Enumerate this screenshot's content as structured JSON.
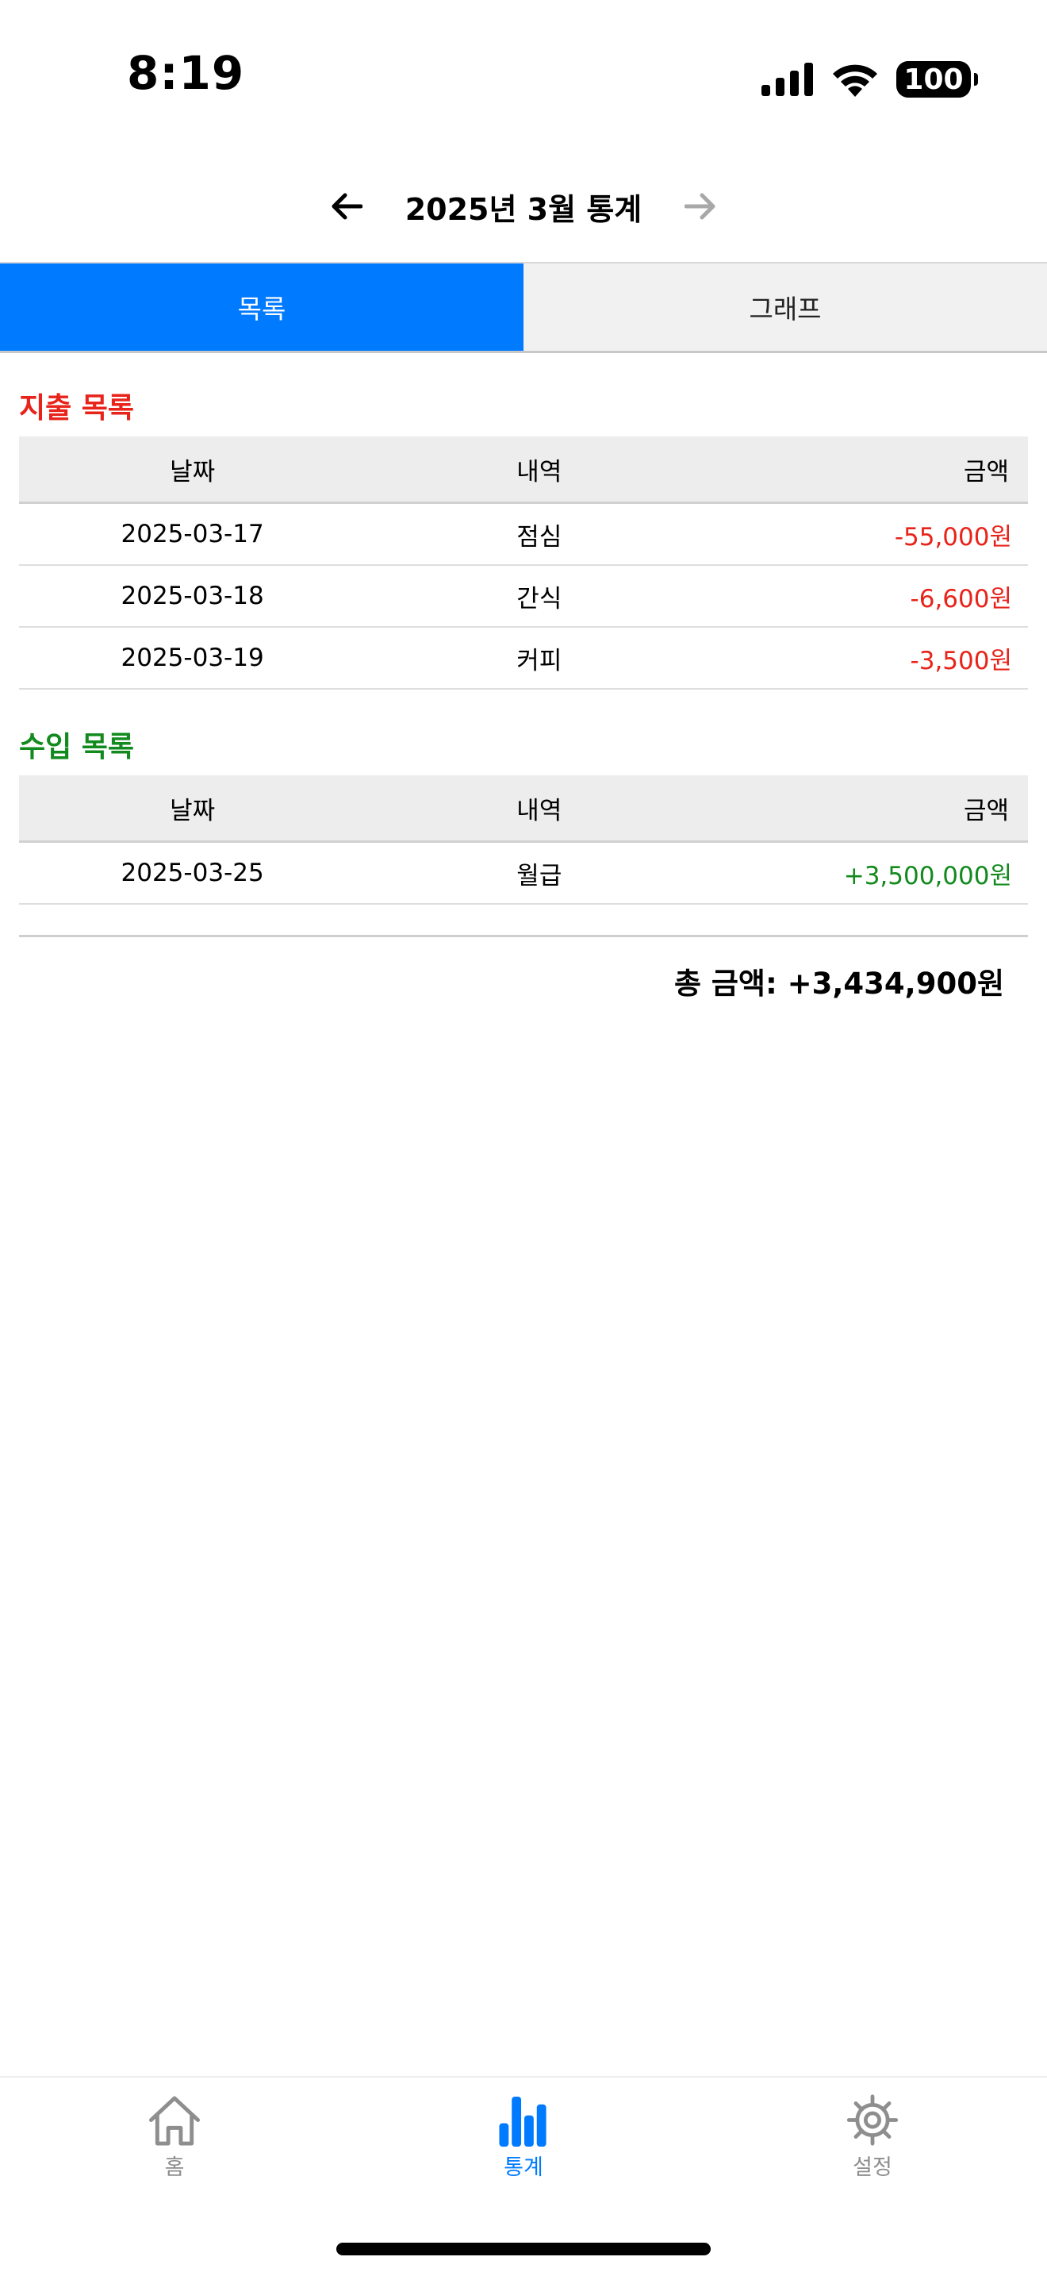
{
  "status_bar": {
    "time": "8:19",
    "battery": "100",
    "icons": [
      "signal-icon",
      "wifi-icon",
      "battery-icon"
    ]
  },
  "header": {
    "title": "2025년 3월 통계",
    "prev_icon": "arrow-left-icon",
    "next_icon": "arrow-right-icon"
  },
  "tabs": [
    {
      "label": "목록",
      "active": true
    },
    {
      "label": "그래프",
      "active": false
    }
  ],
  "expense": {
    "title": "지출 목록",
    "columns": [
      "날짜",
      "내역",
      "금액"
    ],
    "rows": [
      {
        "date": "2025-03-17",
        "desc": "점심",
        "amount": "-55,000원"
      },
      {
        "date": "2025-03-18",
        "desc": "간식",
        "amount": "-6,600원"
      },
      {
        "date": "2025-03-19",
        "desc": "커피",
        "amount": "-3,500원"
      }
    ]
  },
  "income": {
    "title": "수입 목록",
    "columns": [
      "날짜",
      "내역",
      "금액"
    ],
    "rows": [
      {
        "date": "2025-03-25",
        "desc": "월급",
        "amount": "+3,500,000원"
      }
    ]
  },
  "total": "총 금액: +3,434,900원",
  "bottom_nav": [
    {
      "label": "홈",
      "icon": "house-icon",
      "active": false
    },
    {
      "label": "통계",
      "icon": "bar-chart-icon",
      "active": true
    },
    {
      "label": "설정",
      "icon": "gear-icon",
      "active": false
    }
  ],
  "colors": {
    "accent": "#007aff",
    "expense": "#e8231a",
    "income": "#128a1e",
    "inactive": "#8e8e8e"
  }
}
